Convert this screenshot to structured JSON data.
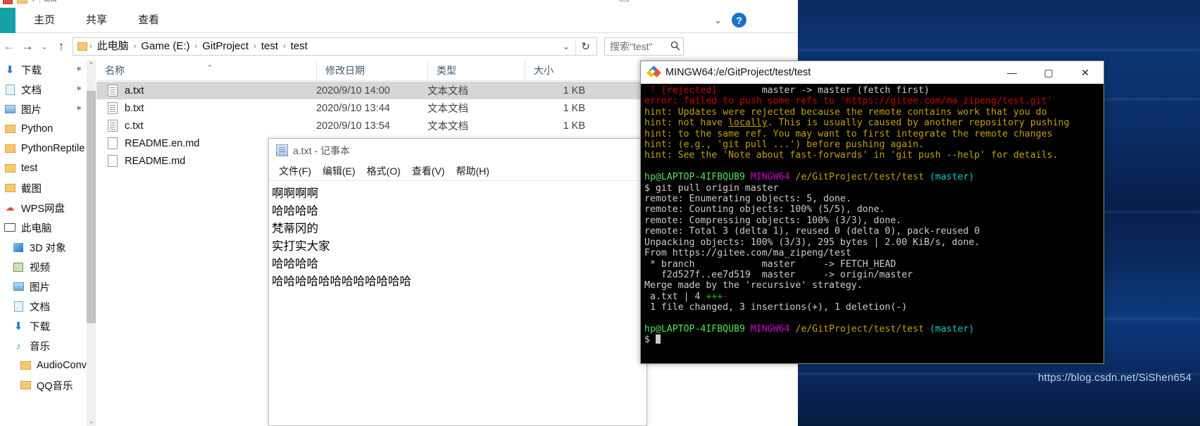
{
  "explorer": {
    "titlebar": {
      "title": "test",
      "restore_label": ""
    },
    "ribbon": {
      "tabs": [
        {
          "label": "主页"
        },
        {
          "label": "共享"
        },
        {
          "label": "查看"
        }
      ],
      "help_glyph": "?",
      "collapse_glyph": "⌄"
    },
    "address": {
      "back_glyph": "←",
      "forward_glyph": "→",
      "recent_glyph": "⌄",
      "up_glyph": "↑",
      "dropdown_glyph": "⌄",
      "refresh_glyph": "↻",
      "separator": "›",
      "breadcrumbs": [
        "此电脑",
        "Game (E:)",
        "GitProject",
        "test",
        "test"
      ]
    },
    "search": {
      "value": "搜索\"test\"",
      "icon_glyph": "🔍"
    },
    "navpane": {
      "scroll_up_glyph": "⌃",
      "scroll_down_glyph": "⌄",
      "items": [
        {
          "label": "下载",
          "icon": "download-icon",
          "pinned": true,
          "indent": 0
        },
        {
          "label": "文档",
          "icon": "documents-icon",
          "pinned": true,
          "indent": 0
        },
        {
          "label": "图片",
          "icon": "pictures-icon",
          "pinned": true,
          "indent": 0
        },
        {
          "label": "Python",
          "icon": "folder-icon",
          "pinned": false,
          "indent": 0
        },
        {
          "label": "PythonReptile",
          "icon": "folder-icon",
          "pinned": false,
          "indent": 0
        },
        {
          "label": "test",
          "icon": "folder-icon",
          "pinned": false,
          "indent": 0
        },
        {
          "label": "截图",
          "icon": "folder-icon",
          "pinned": false,
          "indent": 0
        },
        {
          "label": "WPS网盘",
          "icon": "cloud-icon",
          "pinned": false,
          "indent": 0
        },
        {
          "label": "此电脑",
          "icon": "pc-icon",
          "pinned": false,
          "indent": 0
        },
        {
          "label": "3D 对象",
          "icon": "3d-objects-icon",
          "pinned": false,
          "indent": 1
        },
        {
          "label": "视频",
          "icon": "videos-icon",
          "pinned": false,
          "indent": 1
        },
        {
          "label": "图片",
          "icon": "pictures-icon",
          "pinned": false,
          "indent": 1
        },
        {
          "label": "文档",
          "icon": "documents-icon",
          "pinned": false,
          "indent": 1
        },
        {
          "label": "下载",
          "icon": "download-icon",
          "pinned": false,
          "indent": 1
        },
        {
          "label": "音乐",
          "icon": "music-icon",
          "pinned": false,
          "indent": 1
        },
        {
          "label": "AudioConvert",
          "icon": "folder-icon",
          "pinned": false,
          "indent": 2
        },
        {
          "label": "QQ音乐",
          "icon": "folder-icon",
          "pinned": false,
          "indent": 2
        }
      ]
    },
    "filelist": {
      "columns": [
        "名称",
        "修改日期",
        "类型",
        "大小"
      ],
      "sort_glyph": "⌃",
      "rows": [
        {
          "name": "a.txt",
          "date": "2020/9/10 14:00",
          "type": "文本文档",
          "size": "1 KB",
          "icon": "text-file-icon",
          "selected": true
        },
        {
          "name": "b.txt",
          "date": "2020/9/10 13:44",
          "type": "文本文档",
          "size": "1 KB",
          "icon": "text-file-icon",
          "selected": false
        },
        {
          "name": "c.txt",
          "date": "2020/9/10 13:54",
          "type": "文本文档",
          "size": "1 KB",
          "icon": "text-file-icon",
          "selected": false
        },
        {
          "name": "README.en.md",
          "date": "",
          "type": "",
          "size": "",
          "icon": "md-file-icon",
          "selected": false
        },
        {
          "name": "README.md",
          "date": "",
          "type": "",
          "size": "",
          "icon": "md-file-icon",
          "selected": false
        }
      ]
    }
  },
  "notepad": {
    "title": "a.txt - 记事本",
    "menu": [
      "文件(F)",
      "编辑(E)",
      "格式(O)",
      "查看(V)",
      "帮助(H)"
    ],
    "content_lines": [
      "啊啊啊啊",
      "哈哈哈哈",
      "梵蒂冈的",
      "实打实大家",
      "哈哈哈哈",
      "哈哈哈哈哈哈哈哈哈哈哈哈"
    ]
  },
  "terminal": {
    "title": "MINGW64:/e/GitProject/test/test",
    "window_buttons": {
      "minimize": "—",
      "maximize": "▢",
      "close": "✕"
    },
    "lines": [
      {
        "segments": [
          {
            "t": " ! [rejected]",
            "c": "c-red"
          },
          {
            "t": "        master -> master (fetch first)",
            "c": "c-white"
          }
        ]
      },
      {
        "segments": [
          {
            "t": "error: failed to push some refs to 'https://gitee.com/ma_zipeng/test.git'",
            "c": "c-red"
          }
        ]
      },
      {
        "segments": [
          {
            "t": "hint: Updates were rejected because the remote contains work that you do",
            "c": "c-yellow"
          }
        ]
      },
      {
        "segments": [
          {
            "t": "hint: not have ",
            "c": "c-yellow"
          },
          {
            "t": "locally",
            "c": "c-yellow u"
          },
          {
            "t": ". This is usually caused by another repository pushing",
            "c": "c-yellow"
          }
        ]
      },
      {
        "segments": [
          {
            "t": "hint: to the same ref. You may want to first integrate the remote changes",
            "c": "c-yellow"
          }
        ]
      },
      {
        "segments": [
          {
            "t": "hint: (e.g., 'git pull ...') before pushing again.",
            "c": "c-yellow"
          }
        ]
      },
      {
        "segments": [
          {
            "t": "hint: See the 'Note about fast-forwards' in 'git push --help' for details.",
            "c": "c-yellow"
          }
        ]
      },
      {
        "segments": [
          {
            "t": "",
            "c": "c-white"
          }
        ]
      },
      {
        "segments": [
          {
            "t": "hp@LAPTOP-4IFBQUB9",
            "c": "c-brightgreen"
          },
          {
            "t": " MINGW64",
            "c": "c-magenta"
          },
          {
            "t": " /e/GitProject/test/test",
            "c": "c-olive"
          },
          {
            "t": " (master)",
            "c": "c-cyan"
          }
        ]
      },
      {
        "segments": [
          {
            "t": "$ git pull origin master",
            "c": "c-white"
          }
        ]
      },
      {
        "segments": [
          {
            "t": "remote: Enumerating objects: 5, done.",
            "c": "c-white"
          }
        ]
      },
      {
        "segments": [
          {
            "t": "remote: Counting objects: 100% (5/5), done.",
            "c": "c-white"
          }
        ]
      },
      {
        "segments": [
          {
            "t": "remote: Compressing objects: 100% (3/3), done.",
            "c": "c-white"
          }
        ]
      },
      {
        "segments": [
          {
            "t": "remote: Total 3 (delta 1), reused 0 (delta 0), pack-reused 0",
            "c": "c-white"
          }
        ]
      },
      {
        "segments": [
          {
            "t": "Unpacking objects: 100% (3/3), 295 bytes | 2.00 KiB/s, done.",
            "c": "c-white"
          }
        ]
      },
      {
        "segments": [
          {
            "t": "From https://gitee.com/ma_zipeng/test",
            "c": "c-white"
          }
        ]
      },
      {
        "segments": [
          {
            "t": " * branch            master     -> FETCH_HEAD",
            "c": "c-white"
          }
        ]
      },
      {
        "segments": [
          {
            "t": "   f2d527f..ee7d519  master     -> origin/master",
            "c": "c-white"
          }
        ]
      },
      {
        "segments": [
          {
            "t": "Merge made by the 'recursive' strategy.",
            "c": "c-white"
          }
        ]
      },
      {
        "segments": [
          {
            "t": " a.txt | 4 ",
            "c": "c-white"
          },
          {
            "t": "+++",
            "c": "c-green"
          },
          {
            "t": "-",
            "c": "c-red"
          }
        ]
      },
      {
        "segments": [
          {
            "t": " 1 file changed, 3 insertions(+), 1 deletion(-)",
            "c": "c-white"
          }
        ]
      },
      {
        "segments": [
          {
            "t": "",
            "c": "c-white"
          }
        ]
      },
      {
        "segments": [
          {
            "t": "hp@LAPTOP-4IFBQUB9",
            "c": "c-brightgreen"
          },
          {
            "t": " MINGW64",
            "c": "c-magenta"
          },
          {
            "t": " /e/GitProject/test/test",
            "c": "c-olive"
          },
          {
            "t": " (master)",
            "c": "c-cyan"
          }
        ]
      },
      {
        "segments": [
          {
            "t": "$ ",
            "c": "c-white"
          }
        ]
      }
    ]
  },
  "desktop": {
    "watermark": "https://blog.csdn.net/SiShen654"
  },
  "colors": {
    "ribbon_file_tab": "#16a0a8",
    "selection": "#d6d6d6",
    "help_blue": "#1a73c6",
    "terminal_bg": "#000000",
    "desktop_blue": "#0b2a5e"
  }
}
